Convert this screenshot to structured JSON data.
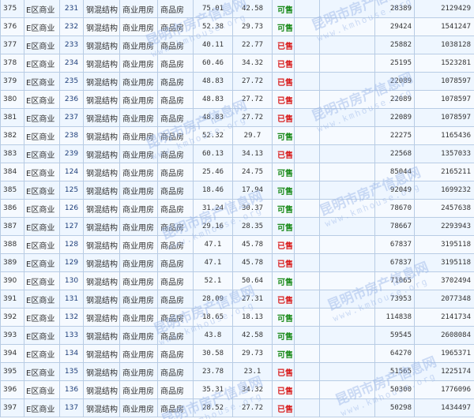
{
  "colors": {
    "available": "#1a8a1a",
    "sold": "#d81e1e",
    "border": "#b8cce4",
    "row_bg": "#eef6ff",
    "room_text": "#1f3f7a"
  },
  "watermark": {
    "text": "昆明市房产信息网",
    "url": "www.kmhouse.org"
  },
  "rows": [
    {
      "seq": "375",
      "cat": "E区商业",
      "room": "231",
      "struct": "钢混结构",
      "use": "商业用房",
      "type": "商品房",
      "area1": "75.01",
      "area2": "42.58",
      "status": "可售",
      "status_key": "avail",
      "price": "28389",
      "total": "2129429"
    },
    {
      "seq": "376",
      "cat": "E区商业",
      "room": "232",
      "struct": "钢混结构",
      "use": "商业用房",
      "type": "商品房",
      "area1": "52.38",
      "area2": "29.73",
      "status": "可售",
      "status_key": "avail",
      "price": "29424",
      "total": "1541247"
    },
    {
      "seq": "377",
      "cat": "E区商业",
      "room": "233",
      "struct": "钢混结构",
      "use": "商业用房",
      "type": "商品房",
      "area1": "40.11",
      "area2": "22.77",
      "status": "已售",
      "status_key": "sold",
      "price": "25882",
      "total": "1038128"
    },
    {
      "seq": "378",
      "cat": "E区商业",
      "room": "234",
      "struct": "钢混结构",
      "use": "商业用房",
      "type": "商品房",
      "area1": "60.46",
      "area2": "34.32",
      "status": "已售",
      "status_key": "sold",
      "price": "25195",
      "total": "1523281"
    },
    {
      "seq": "379",
      "cat": "E区商业",
      "room": "235",
      "struct": "钢混结构",
      "use": "商业用房",
      "type": "商品房",
      "area1": "48.83",
      "area2": "27.72",
      "status": "已售",
      "status_key": "sold",
      "price": "22089",
      "total": "1078597"
    },
    {
      "seq": "380",
      "cat": "E区商业",
      "room": "236",
      "struct": "钢混结构",
      "use": "商业用房",
      "type": "商品房",
      "area1": "48.83",
      "area2": "27.72",
      "status": "已售",
      "status_key": "sold",
      "price": "22089",
      "total": "1078597"
    },
    {
      "seq": "381",
      "cat": "E区商业",
      "room": "237",
      "struct": "钢混结构",
      "use": "商业用房",
      "type": "商品房",
      "area1": "48.83",
      "area2": "27.72",
      "status": "已售",
      "status_key": "sold",
      "price": "22089",
      "total": "1078597"
    },
    {
      "seq": "382",
      "cat": "E区商业",
      "room": "238",
      "struct": "钢混结构",
      "use": "商业用房",
      "type": "商品房",
      "area1": "52.32",
      "area2": "29.7",
      "status": "可售",
      "status_key": "avail",
      "price": "22275",
      "total": "1165436"
    },
    {
      "seq": "383",
      "cat": "E区商业",
      "room": "239",
      "struct": "钢混结构",
      "use": "商业用房",
      "type": "商品房",
      "area1": "60.13",
      "area2": "34.13",
      "status": "已售",
      "status_key": "sold",
      "price": "22568",
      "total": "1357033"
    },
    {
      "seq": "384",
      "cat": "E区商业",
      "room": "124",
      "struct": "钢混结构",
      "use": "商业用房",
      "type": "商品房",
      "area1": "25.46",
      "area2": "24.75",
      "status": "可售",
      "status_key": "avail",
      "price": "85044",
      "total": "2165211"
    },
    {
      "seq": "385",
      "cat": "E区商业",
      "room": "125",
      "struct": "钢混结构",
      "use": "商业用房",
      "type": "商品房",
      "area1": "18.46",
      "area2": "17.94",
      "status": "可售",
      "status_key": "avail",
      "price": "92049",
      "total": "1699232"
    },
    {
      "seq": "386",
      "cat": "E区商业",
      "room": "126",
      "struct": "钢混结构",
      "use": "商业用房",
      "type": "商品房",
      "area1": "31.24",
      "area2": "30.37",
      "status": "可售",
      "status_key": "avail",
      "price": "78670",
      "total": "2457638"
    },
    {
      "seq": "387",
      "cat": "E区商业",
      "room": "127",
      "struct": "钢混结构",
      "use": "商业用房",
      "type": "商品房",
      "area1": "29.16",
      "area2": "28.35",
      "status": "可售",
      "status_key": "avail",
      "price": "78667",
      "total": "2293943"
    },
    {
      "seq": "388",
      "cat": "E区商业",
      "room": "128",
      "struct": "钢混结构",
      "use": "商业用房",
      "type": "商品房",
      "area1": "47.1",
      "area2": "45.78",
      "status": "已售",
      "status_key": "sold",
      "price": "67837",
      "total": "3195118"
    },
    {
      "seq": "389",
      "cat": "E区商业",
      "room": "129",
      "struct": "钢混结构",
      "use": "商业用房",
      "type": "商品房",
      "area1": "47.1",
      "area2": "45.78",
      "status": "已售",
      "status_key": "sold",
      "price": "67837",
      "total": "3195118"
    },
    {
      "seq": "390",
      "cat": "E区商业",
      "room": "130",
      "struct": "钢混结构",
      "use": "商业用房",
      "type": "商品房",
      "area1": "52.1",
      "area2": "50.64",
      "status": "可售",
      "status_key": "avail",
      "price": "71065",
      "total": "3702494"
    },
    {
      "seq": "391",
      "cat": "E区商业",
      "room": "131",
      "struct": "钢混结构",
      "use": "商业用房",
      "type": "商品房",
      "area1": "28.09",
      "area2": "27.31",
      "status": "已售",
      "status_key": "sold",
      "price": "73953",
      "total": "2077348"
    },
    {
      "seq": "392",
      "cat": "E区商业",
      "room": "132",
      "struct": "钢混结构",
      "use": "商业用房",
      "type": "商品房",
      "area1": "18.65",
      "area2": "18.13",
      "status": "可售",
      "status_key": "avail",
      "price": "114838",
      "total": "2141734"
    },
    {
      "seq": "393",
      "cat": "E区商业",
      "room": "133",
      "struct": "钢混结构",
      "use": "商业用房",
      "type": "商品房",
      "area1": "43.8",
      "area2": "42.58",
      "status": "可售",
      "status_key": "avail",
      "price": "59545",
      "total": "2608084"
    },
    {
      "seq": "394",
      "cat": "E区商业",
      "room": "134",
      "struct": "钢混结构",
      "use": "商业用房",
      "type": "商品房",
      "area1": "30.58",
      "area2": "29.73",
      "status": "可售",
      "status_key": "avail",
      "price": "64270",
      "total": "1965371"
    },
    {
      "seq": "395",
      "cat": "E区商业",
      "room": "135",
      "struct": "钢混结构",
      "use": "商业用房",
      "type": "商品房",
      "area1": "23.78",
      "area2": "23.1",
      "status": "已售",
      "status_key": "sold",
      "price": "51565",
      "total": "1225174"
    },
    {
      "seq": "396",
      "cat": "E区商业",
      "room": "136",
      "struct": "钢混结构",
      "use": "商业用房",
      "type": "商品房",
      "area1": "35.31",
      "area2": "34.32",
      "status": "已售",
      "status_key": "sold",
      "price": "50300",
      "total": "1776096"
    },
    {
      "seq": "397",
      "cat": "E区商业",
      "room": "137",
      "struct": "钢混结构",
      "use": "商业用房",
      "type": "商品房",
      "area1": "28.52",
      "area2": "27.72",
      "status": "已售",
      "status_key": "sold",
      "price": "50298",
      "total": "1434497"
    }
  ]
}
